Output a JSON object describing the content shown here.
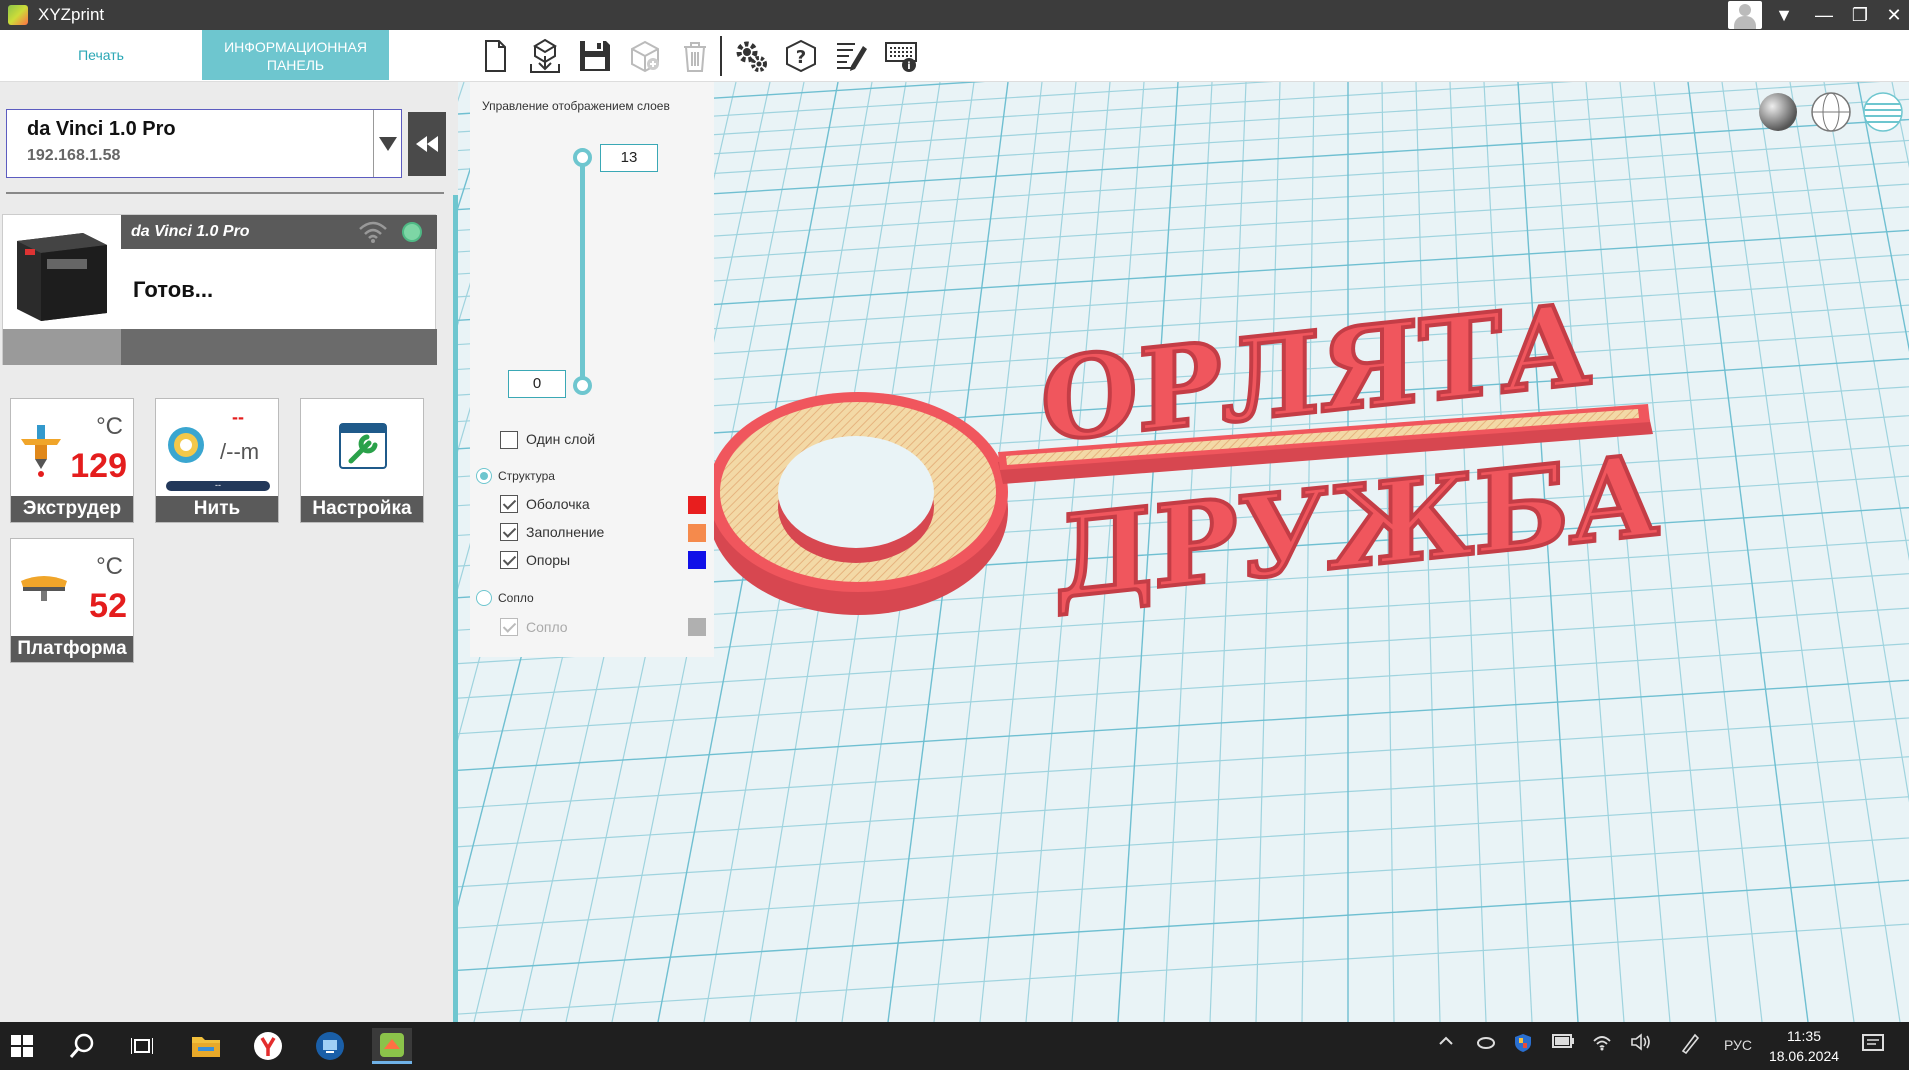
{
  "window": {
    "title": "XYZprint"
  },
  "tabs": {
    "print": "Печать",
    "dashboard_line1": "ИНФОРМАЦИОННАЯ",
    "dashboard_line2": "ПАНЕЛЬ"
  },
  "printer_select": {
    "name": "da Vinci 1.0 Pro",
    "ip": "192.168.1.58"
  },
  "printer_card": {
    "name": "da Vinci 1.0 Pro",
    "status": "Готов..."
  },
  "tiles": {
    "extruder": {
      "unit": "°C",
      "temp": "129",
      "label": "Экструдер"
    },
    "filament": {
      "value": "--",
      "length": "/--m",
      "sub": "--",
      "label": "Нить"
    },
    "settings": {
      "label": "Настройка"
    },
    "platform": {
      "unit": "°C",
      "temp": "52",
      "label": "Платформа"
    }
  },
  "layer_panel": {
    "title": "Управление отображением слоев",
    "top_layer": "13",
    "bottom_layer": "0",
    "single_layer": "Один слой",
    "structure": "Структура",
    "shell": "Оболочка",
    "infill": "Заполнение",
    "supports": "Опоры",
    "nozzle_group": "Сопло",
    "nozzle": "Сопло"
  },
  "colors": {
    "accent": "#6ec6cf",
    "shell": "#e81e1e",
    "infill": "#f58a4c",
    "supports": "#1010e8",
    "nozzle": "#b0b0b0",
    "model": "#f0565d",
    "infill_pattern": "#f3d9a6"
  },
  "model": {
    "line1": "ОРЛЯТА",
    "line2": "ДРУЖБА"
  },
  "taskbar": {
    "language": "РУС",
    "time": "11:35",
    "date": "18.06.2024"
  }
}
